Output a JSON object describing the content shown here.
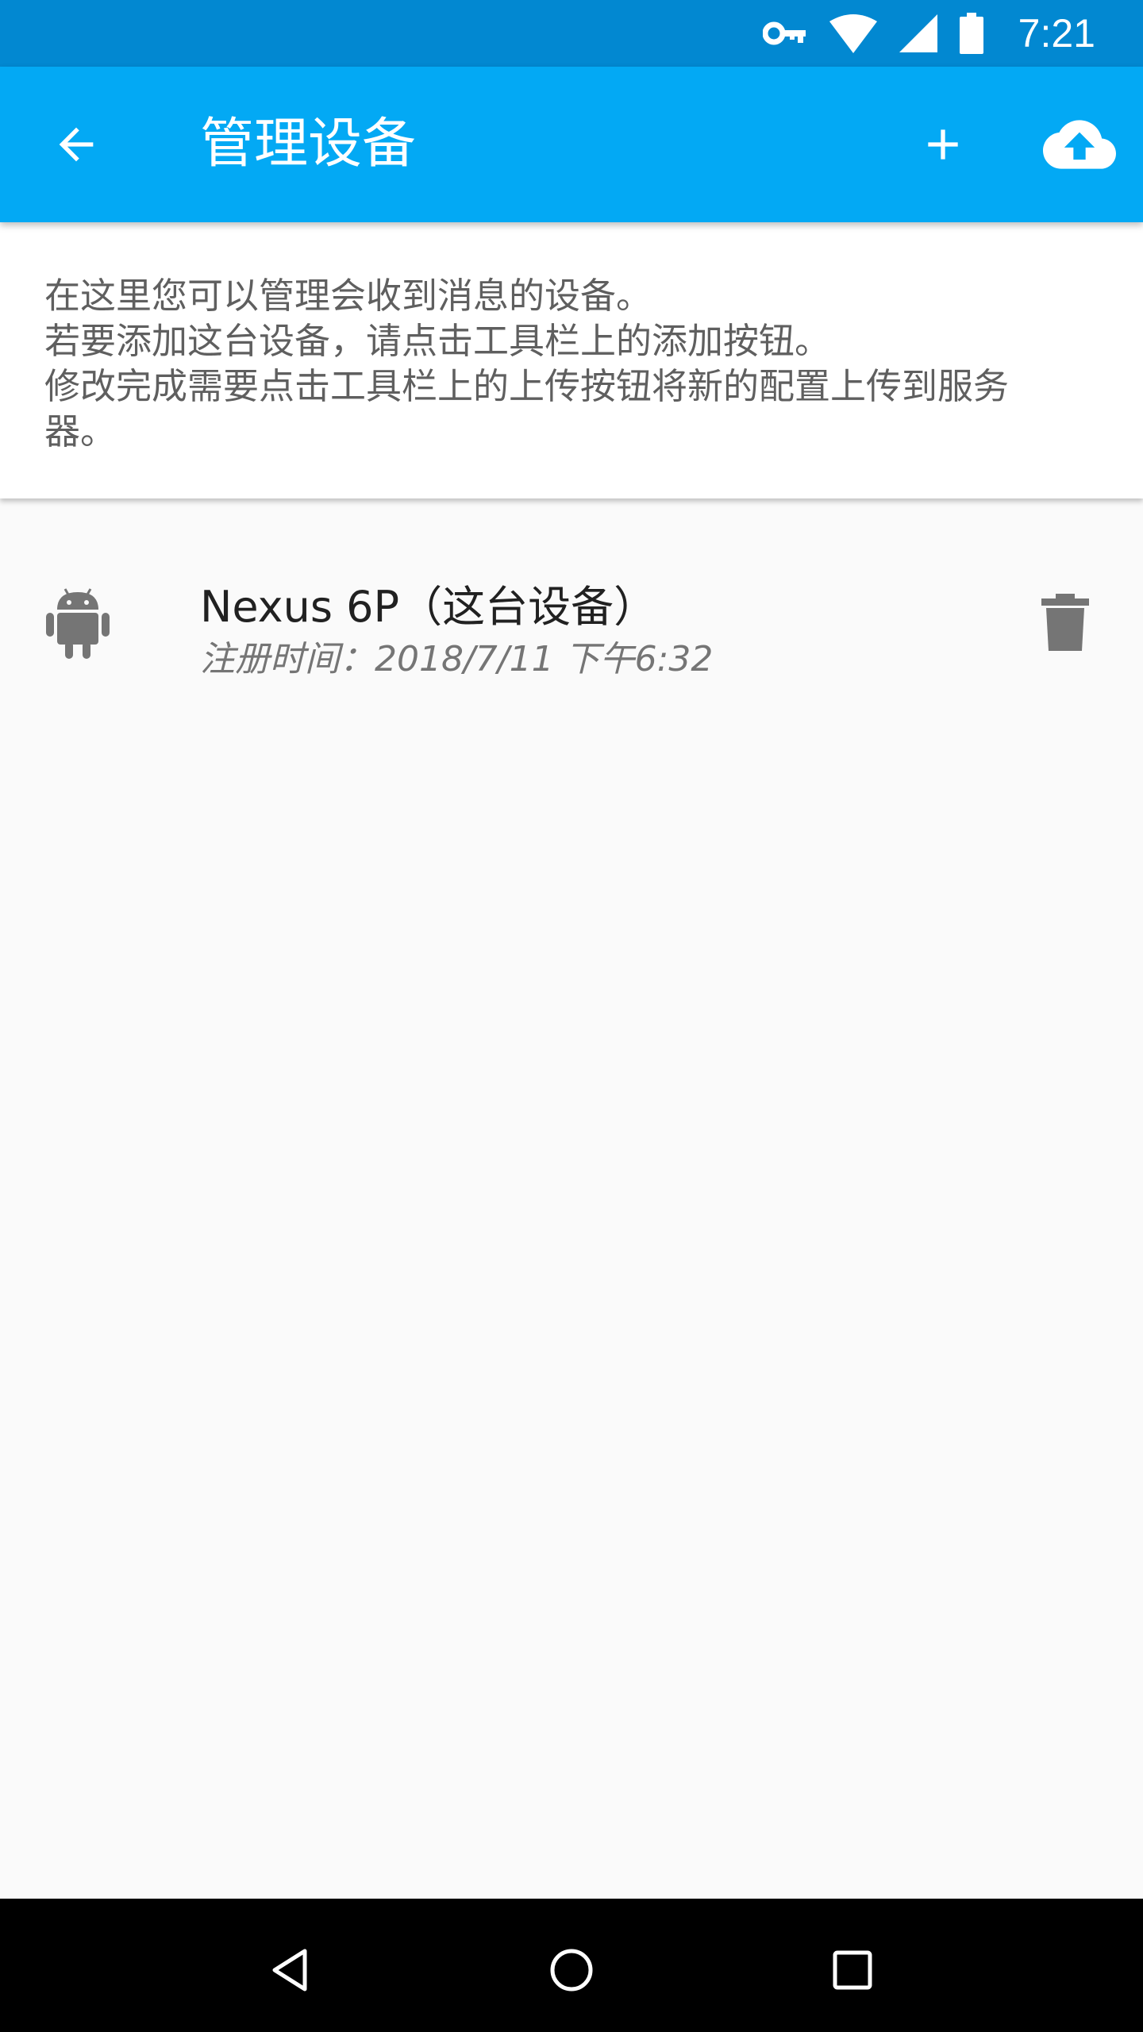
{
  "status_bar": {
    "time": "7:21",
    "icons": [
      "vpn-key-icon",
      "wifi-icon",
      "cellular-signal-icon",
      "battery-icon"
    ]
  },
  "app_bar": {
    "title": "管理设备",
    "back_icon": "arrow-back-icon",
    "add_icon": "add-icon",
    "upload_icon": "cloud-upload-icon"
  },
  "info": {
    "lines": [
      "在这里您可以管理会收到消息的设备。",
      "若要添加这台设备，请点击工具栏上的添加按钮。",
      "修改完成需要点击工具栏上的上传按钮将新的配置上传到服务",
      "器。"
    ]
  },
  "devices": [
    {
      "name": "Nexus 6P（这台设备）",
      "registered": "注册时间：2018/7/11 下午6:32",
      "icon": "android-icon",
      "action_icon": "delete-icon"
    }
  ],
  "nav_bar": {
    "icons": [
      "back-triangle-icon",
      "home-circle-icon",
      "recents-square-icon"
    ]
  },
  "colors": {
    "status_bar": "#0288d1",
    "app_bar": "#03a9f4",
    "background": "#fafafa",
    "card": "#ffffff",
    "icon_grey": "#757575"
  }
}
